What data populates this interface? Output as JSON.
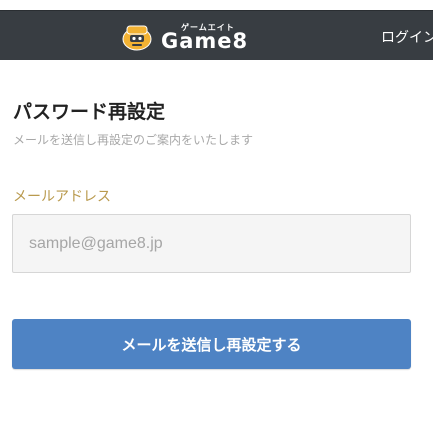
{
  "header": {
    "logo_kana": "ゲームエイト",
    "logo_word": "Game8",
    "logo_icon": "game8-mascot-icon",
    "login_label": "ログイン"
  },
  "main": {
    "title": "パスワード再設定",
    "subtitle": "メールを送信し再設定のご案内をいたします",
    "email_label": "メールアドレス",
    "email_placeholder": "sample@game8.jp",
    "email_value": "",
    "submit_label": "メールを送信し再設定する"
  },
  "colors": {
    "header_bg": "#383d42",
    "label_gold": "#b99a4e",
    "button_blue": "#4e83c4",
    "input_bg": "#f5f5f5"
  }
}
